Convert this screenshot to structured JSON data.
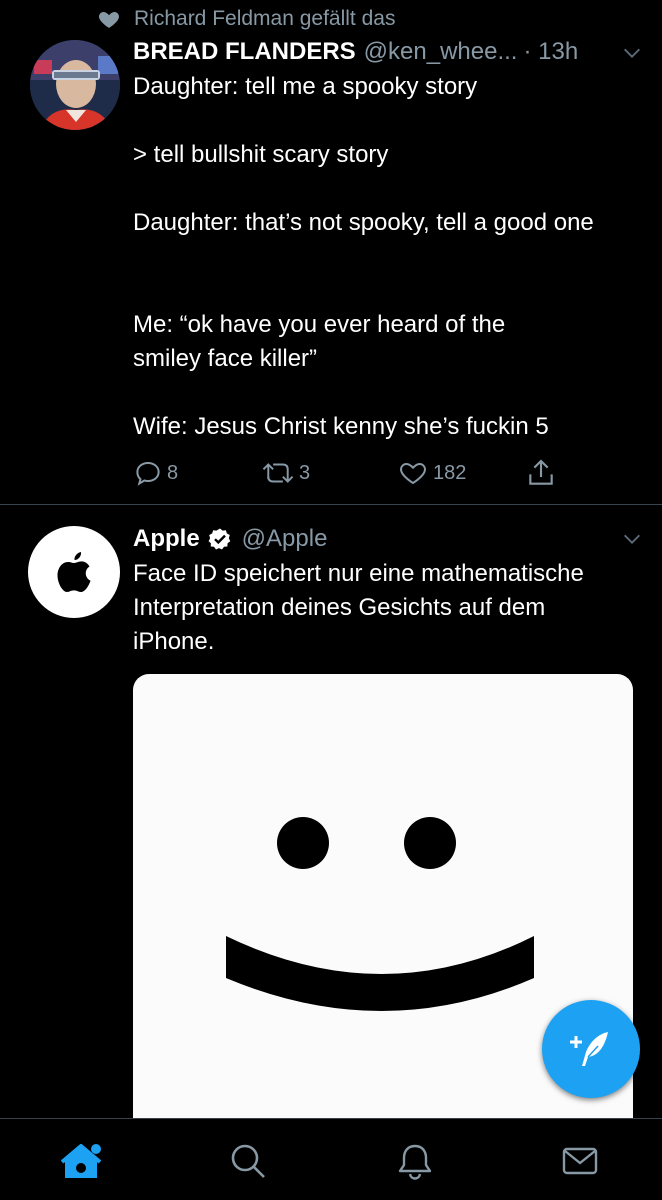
{
  "tweet1": {
    "social_context": "Richard Feldman gefällt das",
    "name": "BREAD FLANDERS",
    "handle": "@ken_whee...",
    "time": "· 13h",
    "text_lines": [
      "Daughter: tell me a spooky story",
      "> tell bullshit scary story",
      "Daughter: that’s not spooky, tell a good one",
      "Me: “ok have you ever heard of the smiley face killer”",
      "Wife: Jesus Christ kenny she’s fuckin 5"
    ],
    "replies": "8",
    "retweets": "3",
    "likes": "182"
  },
  "tweet2": {
    "name": "Apple",
    "handle": "@Apple",
    "text": "Face ID speichert nur eine mathematische Interpretation deines Gesichts auf dem iPhone."
  },
  "nav": {
    "items": [
      "home-icon",
      "search-icon",
      "notifications-icon",
      "messages-icon"
    ]
  },
  "colors": {
    "background": "#000000",
    "secondary_text": "#8899a6",
    "accent": "#1da1f2",
    "divider": "#38444d"
  }
}
